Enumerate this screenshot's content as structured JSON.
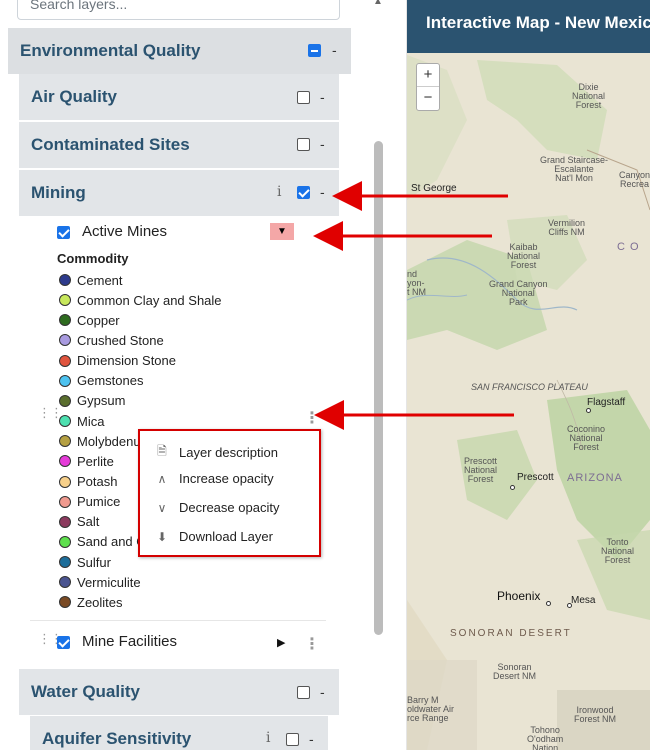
{
  "search": {
    "placeholder": "Search layers..."
  },
  "groups": {
    "environmental_quality": {
      "label": "Environmental Quality",
      "dash": "-"
    },
    "air_quality": {
      "label": "Air Quality",
      "dash": "-"
    },
    "contaminated_sites": {
      "label": "Contaminated Sites",
      "dash": "-"
    },
    "mining": {
      "label": "Mining",
      "info": "i",
      "dash": "-"
    },
    "water_quality": {
      "label": "Water Quality",
      "dash": "-"
    },
    "aquifer_sensitivity": {
      "label": "Aquifer Sensitivity",
      "info": "i",
      "dash": "-"
    }
  },
  "active_mines": {
    "label": "Active Mines",
    "toggle": "▼",
    "legend_title": "Commodity",
    "items": [
      {
        "label": "Cement",
        "color": "#2d3a8c"
      },
      {
        "label": "Common Clay and Shale",
        "color": "#c8e85c"
      },
      {
        "label": "Copper",
        "color": "#2e6b1f"
      },
      {
        "label": "Crushed Stone",
        "color": "#a99be0"
      },
      {
        "label": "Dimension Stone",
        "color": "#e0543e"
      },
      {
        "label": "Gemstones",
        "color": "#4dc3f0"
      },
      {
        "label": "Gypsum",
        "color": "#5a6e2e"
      },
      {
        "label": "Mica",
        "color": "#4de0b0"
      },
      {
        "label": "Molybdenum",
        "color": "#b5a042"
      },
      {
        "label": "Perlite",
        "color": "#e53bd8"
      },
      {
        "label": "Potash",
        "color": "#f7d08a"
      },
      {
        "label": "Pumice",
        "color": "#f09a8f"
      },
      {
        "label": "Salt",
        "color": "#8c3a5e"
      },
      {
        "label": "Sand and Gravel",
        "color": "#5ee04d"
      },
      {
        "label": "Sulfur",
        "color": "#1e6e9a"
      },
      {
        "label": "Vermiculite",
        "color": "#4a5490"
      },
      {
        "label": "Zeolites",
        "color": "#7a4a24"
      }
    ]
  },
  "mine_facilities": {
    "label": "Mine Facilities",
    "toggle": "▶"
  },
  "context_menu": {
    "items": [
      {
        "label": "Layer description",
        "icon": "document-icon"
      },
      {
        "label": "Increase opacity",
        "icon": "chevron-up-icon"
      },
      {
        "label": "Decrease opacity",
        "icon": "chevron-down-icon"
      },
      {
        "label": "Download Layer",
        "icon": "download-icon"
      }
    ]
  },
  "map": {
    "title": "Interactive Map - New Mexico",
    "zoom_in": "+",
    "zoom_out": "−",
    "labels": {
      "dixie": "Dixie\nNational\nForest",
      "grand_staircase": "Grand Staircase-\nEscalante\nNat'l Mon",
      "canyons": "Canyon\nRecrea",
      "st_george": "St George",
      "vermilion": "Vermilion\nCliffs NM",
      "co": "C   O",
      "kaibab": "Kaibab\nNational\nForest",
      "grand_canyon": "Grand Canyon\nNational\nPark",
      "nd_nm": "nd\nyon-\nt NM",
      "sf_plateau": "SAN FRANCISCO PLATEAU",
      "flagstaff": "Flagstaff",
      "coconino": "Coconino\nNational\nForest",
      "prescott_nf": "Prescott\nNational\nForest",
      "prescott": "Prescott",
      "arizona": "ARIZONA",
      "tonto": "Tonto\nNational\nForest",
      "phoenix": "Phoenix",
      "mesa": "Mesa",
      "sonoran_desert": "SONORAN DESERT",
      "sonoran_nm": "Sonoran\nDesert NM",
      "barry": "Barry M\noldwater Air\nrce Range",
      "ironwood": "Ironwood\nForest NM",
      "tohono": "Tohono\nO'odham\nNation"
    }
  },
  "colors": {
    "header_blue": "#2b5370",
    "annotation_red": "#e00000"
  }
}
